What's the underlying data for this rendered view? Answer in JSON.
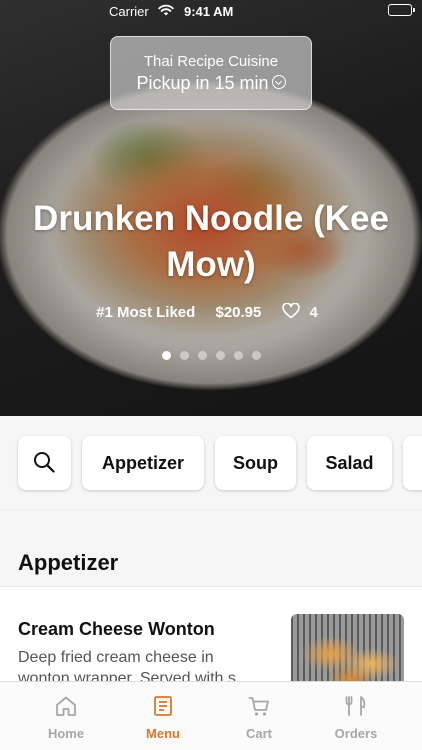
{
  "status_bar": {
    "carrier": "Carrier",
    "time": "9:41 AM"
  },
  "pickup": {
    "restaurant_name": "Thai Recipe Cuisine",
    "pickup_time": "Pickup in 15 min"
  },
  "featured": {
    "title": "Drunken Noodle (Kee Mow)",
    "rank": "#1 Most Liked",
    "price": "$20.95",
    "likes": "4",
    "carousel_count": 6,
    "carousel_active_index": 0
  },
  "categories": {
    "search_icon": "search-icon",
    "items": [
      "Appetizer",
      "Soup",
      "Salad"
    ]
  },
  "menu": {
    "section_title": "Appetizer",
    "items": [
      {
        "name": "Cream Cheese Wonton",
        "description": "Deep fried cream cheese in wonton wrapper. Served with s..."
      }
    ]
  },
  "tab_bar": {
    "tabs": [
      {
        "label": "Home",
        "icon": "home-icon"
      },
      {
        "label": "Menu",
        "icon": "menu-icon"
      },
      {
        "label": "Cart",
        "icon": "cart-icon"
      },
      {
        "label": "Orders",
        "icon": "orders-icon"
      }
    ],
    "active": "Menu"
  },
  "colors": {
    "accent": "#d9772e",
    "inactive_tab": "#a7a7a7",
    "background": "#f6f6f6"
  }
}
